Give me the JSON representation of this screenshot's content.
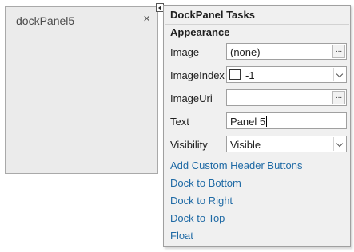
{
  "dock_panel": {
    "caption": "dockPanel5",
    "close_glyph": "×"
  },
  "tasks": {
    "title": "DockPanel Tasks",
    "section": "Appearance",
    "properties": {
      "image": {
        "label": "Image",
        "value": "(none)",
        "button": "..."
      },
      "image_index": {
        "label": "ImageIndex",
        "value": "-1"
      },
      "image_uri": {
        "label": "ImageUri",
        "value": "",
        "button": "..."
      },
      "text": {
        "label": "Text",
        "value": "Panel 5"
      },
      "visibility": {
        "label": "Visibility",
        "value": "Visible"
      }
    },
    "links": [
      "Add Custom Header Buttons",
      "Dock to Bottom",
      "Dock to Right",
      "Dock to Top",
      "Float"
    ]
  },
  "colors": {
    "link": "#1f6aa5",
    "panel_bg": "#ebebeb",
    "tasks_bg": "#f0f0f0"
  }
}
